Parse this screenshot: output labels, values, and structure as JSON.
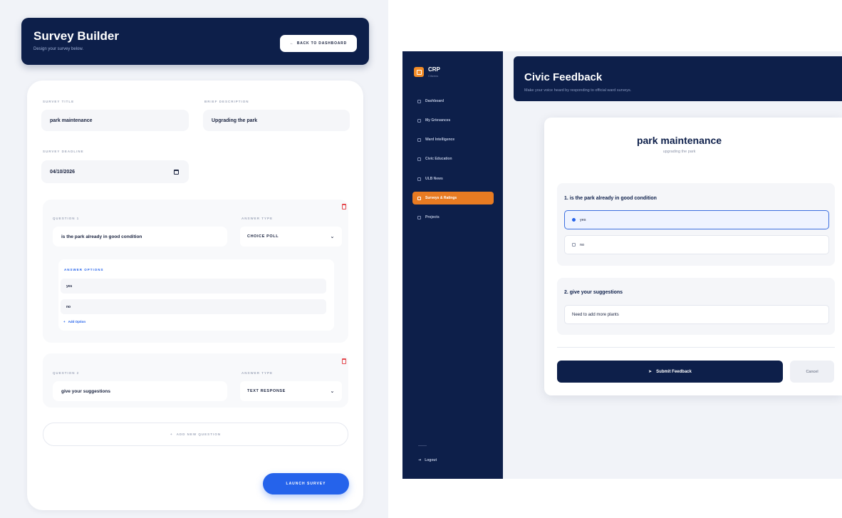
{
  "builder": {
    "title": "Survey Builder",
    "subtitle": "Design your survey below.",
    "back_button": "BACK TO DASHBOARD",
    "survey_title_label": "SURVEY TITLE",
    "survey_title_value": "park maintenance",
    "desc_label": "BRIEF DESCRIPTION",
    "desc_value": "Upgrading the park",
    "deadline_label": "SURVEY DEADLINE",
    "deadline_value": "04/10/2026",
    "questions": [
      {
        "label": "QUESTION 1",
        "type_label": "ANSWER TYPE",
        "text": "is the park already in good condition",
        "type": "CHOICE POLL",
        "options_label": "ANSWER OPTIONS",
        "options": [
          "yes",
          "no"
        ],
        "add_option": "Add Option"
      },
      {
        "label": "QUESTION 2",
        "type_label": "ANSWER TYPE",
        "text": "give your suggestions",
        "type": "TEXT RESPONSE"
      }
    ],
    "add_question": "ADD NEW QUESTION",
    "launch_button": "LAUNCH SURVEY"
  },
  "app": {
    "logo": "CRP",
    "logo_sub": "Citizens",
    "nav": [
      {
        "label": "Dashboard",
        "active": false
      },
      {
        "label": "My Grievances",
        "active": false
      },
      {
        "label": "Ward Intelligence",
        "active": false
      },
      {
        "label": "Civic Education",
        "active": false
      },
      {
        "label": "ULB News",
        "active": false
      },
      {
        "label": "Surveys & Ratings",
        "active": true
      },
      {
        "label": "Projects",
        "active": false
      }
    ],
    "logout": "Logout",
    "header_title": "Civic Feedback",
    "header_subtitle": "Make your voice heard by responding to official ward surveys.",
    "form": {
      "title": "park maintenance",
      "subtitle": "upgrading the park",
      "q1": "1. is the park already in good condition",
      "q1_options": [
        "yes",
        "no"
      ],
      "q1_selected": "yes",
      "q2": "2. give your suggestions",
      "q2_answer": "Need to add more plants",
      "submit": "Submit Feedback",
      "cancel": "Cancel"
    }
  },
  "colors": {
    "navy": "#0d1f4a",
    "accent_orange": "#e87b22",
    "primary_blue": "#2563eb",
    "danger_red": "#e5484d"
  }
}
